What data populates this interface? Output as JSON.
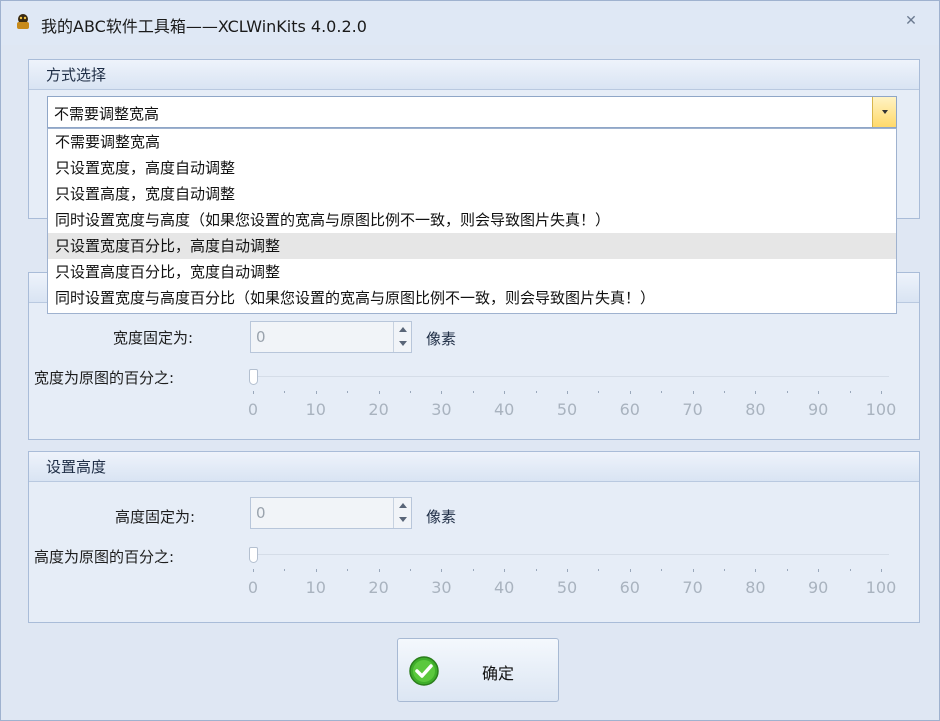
{
  "window": {
    "title": "我的ABC软件工具箱——XCLWinKits  4.0.2.0",
    "close_symbol": "✕",
    "app_icon": "app-logo-icon"
  },
  "mode_group": {
    "title": "方式选择",
    "combo_value": "不需要调整宽高",
    "options": [
      "不需要调整宽高",
      "只设置宽度，高度自动调整",
      "只设置高度，宽度自动调整",
      "同时设置宽度与高度（如果您设置的宽高与原图比例不一致，则会导致图片失真！）",
      "只设置宽度百分比，高度自动调整",
      "只设置高度百分比，宽度自动调整",
      "同时设置宽度与高度百分比（如果您设置的宽高与原图比例不一致，则会导致图片失真！）"
    ],
    "highlighted_index": 4
  },
  "width_group": {
    "fixed_label": "宽度固定为:",
    "fixed_value": "0",
    "unit": "像素",
    "percent_label": "宽度为原图的百分之:",
    "percent_value": 0,
    "ticks": [
      "0",
      "10",
      "20",
      "30",
      "40",
      "50",
      "60",
      "70",
      "80",
      "90",
      "100"
    ]
  },
  "height_group": {
    "title": "设置高度",
    "fixed_label": "高度固定为:",
    "fixed_value": "0",
    "unit": "像素",
    "percent_label": "高度为原图的百分之:",
    "percent_value": 0,
    "ticks": [
      "0",
      "10",
      "20",
      "30",
      "40",
      "50",
      "60",
      "70",
      "80",
      "90",
      "100"
    ]
  },
  "ok_button": {
    "label": "确定",
    "icon": "check-circle-icon"
  },
  "colors": {
    "accent": "#ffd96a",
    "check_green": "#3fae2a"
  }
}
